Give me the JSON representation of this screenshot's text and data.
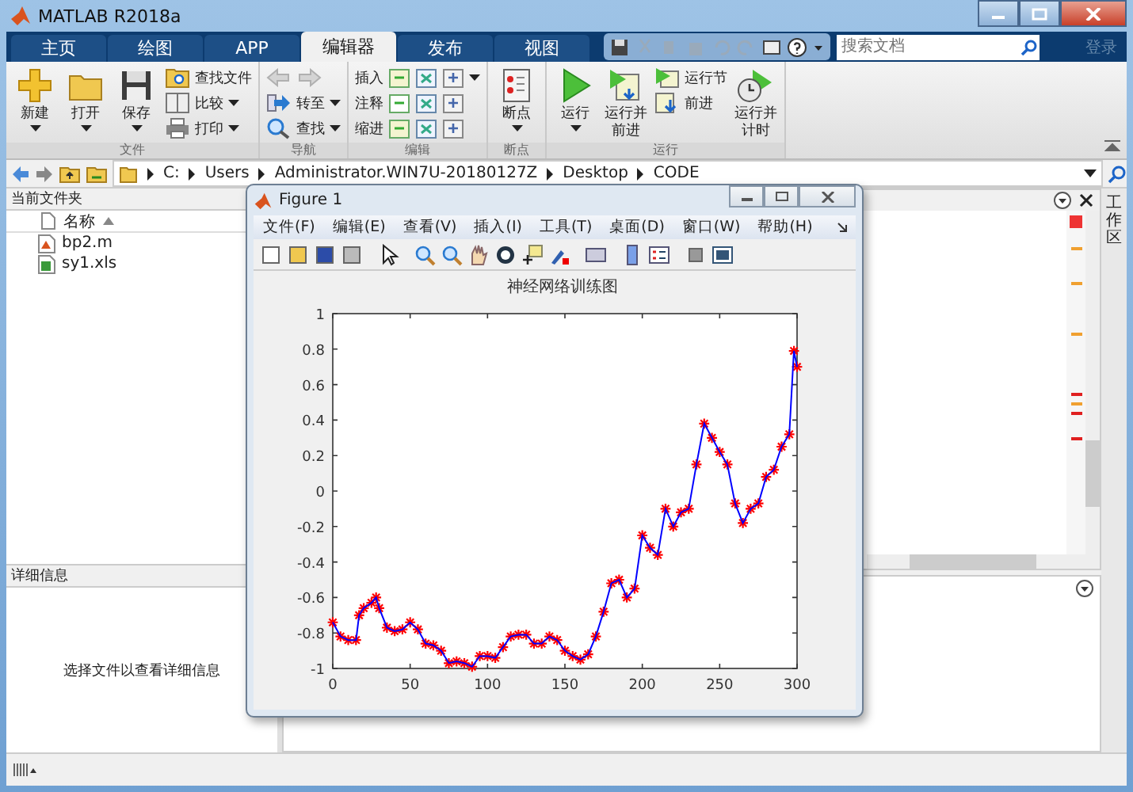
{
  "window": {
    "title": "MATLAB R2018a"
  },
  "ribbon_tabs": [
    {
      "label": "主页",
      "selected": false
    },
    {
      "label": "绘图",
      "selected": false
    },
    {
      "label": "APP",
      "selected": false
    },
    {
      "label": "编辑器",
      "selected": true
    },
    {
      "label": "发布",
      "selected": false
    },
    {
      "label": "视图",
      "selected": false
    }
  ],
  "search": {
    "placeholder": "搜索文档"
  },
  "login": "登录",
  "ribbon_groups": [
    {
      "label": "文件",
      "columns": [
        [
          {
            "kind": "large",
            "label": "新建",
            "dropdown": true
          }
        ],
        [
          {
            "kind": "large",
            "label": "打开",
            "dropdown": true
          }
        ],
        [
          {
            "kind": "large",
            "label": "保存",
            "dropdown": true
          }
        ],
        [
          {
            "kind": "small",
            "label": "查找文件",
            "dropdown": false
          },
          {
            "kind": "small",
            "label": "比较",
            "dropdown": true
          },
          {
            "kind": "small",
            "label": "打印",
            "dropdown": true
          }
        ]
      ]
    },
    {
      "label": "导航",
      "columns": [
        [
          {
            "kind": "nav",
            "disabled": true
          },
          {
            "kind": "small",
            "label": "转至",
            "dropdown": true
          },
          {
            "kind": "small",
            "label": "查找",
            "dropdown": true
          }
        ]
      ]
    },
    {
      "label": "编辑",
      "columns": [
        [
          {
            "kind": "labeled",
            "label": "插入",
            "dropdown": true
          },
          {
            "kind": "labeled",
            "label": "注释",
            "dropdown": false
          },
          {
            "kind": "labeled",
            "label": "缩进",
            "dropdown": false
          }
        ]
      ]
    },
    {
      "label": "断点",
      "columns": [
        [
          {
            "kind": "large",
            "label": "断点",
            "dropdown": true
          }
        ]
      ]
    },
    {
      "label": "运行",
      "columns": [
        [
          {
            "kind": "large",
            "label": "运行",
            "dropdown": true
          }
        ],
        [
          {
            "kind": "large",
            "label": "运行并前进",
            "dropdown": false
          }
        ],
        [
          {
            "kind": "small",
            "label": "运行节",
            "dropdown": false
          },
          {
            "kind": "small",
            "label": "前进",
            "dropdown": false
          }
        ],
        [
          {
            "kind": "large",
            "label": "运行并计时",
            "dropdown": false
          }
        ]
      ]
    }
  ],
  "path": [
    "C:",
    "Users",
    "Administrator.WIN7U-20180127Z",
    "Desktop",
    "CODE"
  ],
  "current_folder": {
    "title": "当前文件夹",
    "column": "名称",
    "files": [
      {
        "name": "bp2.m",
        "kind": "m"
      },
      {
        "name": "sy1.xls",
        "kind": "xls"
      }
    ]
  },
  "details": {
    "title": "详细信息",
    "message": "选择文件以查看详细信息"
  },
  "workspace_tab": "工作区",
  "figure": {
    "title": "Figure 1",
    "menu": [
      "文件(F)",
      "编辑(E)",
      "查看(V)",
      "插入(I)",
      "工具(T)",
      "桌面(D)",
      "窗口(W)",
      "帮助(H)"
    ],
    "chart_data": {
      "type": "line",
      "title": "神经网络训练图",
      "x": [
        0,
        5,
        10,
        15,
        17,
        20,
        25,
        28,
        30,
        35,
        40,
        45,
        50,
        55,
        60,
        65,
        70,
        75,
        80,
        85,
        90,
        95,
        100,
        105,
        110,
        115,
        120,
        125,
        130,
        135,
        140,
        145,
        150,
        155,
        160,
        165,
        170,
        175,
        180,
        185,
        190,
        195,
        200,
        205,
        210,
        215,
        220,
        225,
        230,
        235,
        240,
        245,
        250,
        255,
        260,
        265,
        270,
        275,
        280,
        285,
        290,
        295,
        298,
        300
      ],
      "series": [
        {
          "color": "#0000ff",
          "marker": "cross",
          "values": [
            -0.74,
            -0.82,
            -0.84,
            -0.84,
            -0.7,
            -0.66,
            -0.63,
            -0.6,
            -0.66,
            -0.77,
            -0.79,
            -0.78,
            -0.74,
            -0.78,
            -0.86,
            -0.87,
            -0.9,
            -0.97,
            -0.96,
            -0.97,
            -0.99,
            -0.93,
            -0.93,
            -0.94,
            -0.88,
            -0.82,
            -0.81,
            -0.81,
            -0.86,
            -0.86,
            -0.82,
            -0.84,
            -0.9,
            -0.93,
            -0.95,
            -0.92,
            -0.82,
            -0.68,
            -0.52,
            -0.5,
            -0.6,
            -0.55,
            -0.25,
            -0.32,
            -0.36,
            -0.1,
            -0.2,
            -0.12,
            -0.1,
            0.15,
            0.38,
            0.3,
            0.22,
            0.15,
            -0.07,
            -0.18,
            -0.1,
            -0.07,
            0.08,
            0.12,
            0.25,
            0.32,
            0.79,
            0.7
          ]
        }
      ],
      "xlim": [
        0,
        300
      ],
      "ylim": [
        -1,
        1
      ],
      "xticks": [
        0,
        50,
        100,
        150,
        200,
        250,
        300
      ],
      "yticks": [
        -1,
        -0.8,
        -0.6,
        -0.4,
        -0.2,
        0,
        0.2,
        0.4,
        0.6,
        0.8,
        1
      ]
    }
  }
}
